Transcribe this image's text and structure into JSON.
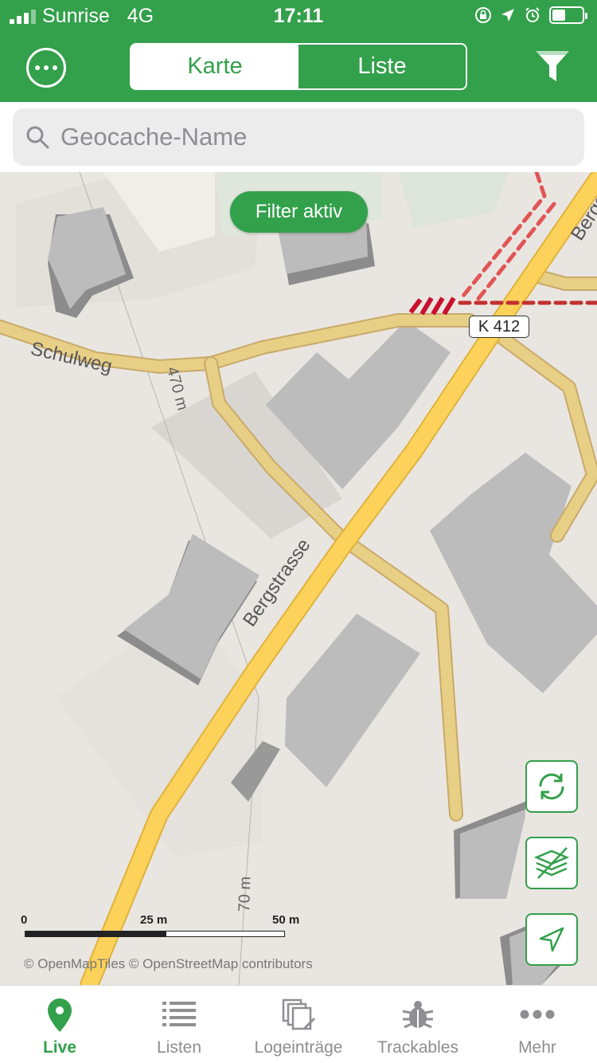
{
  "status_bar": {
    "carrier": "Sunrise",
    "network": "4G",
    "time": "17:11",
    "battery_level": 0.45
  },
  "nav": {
    "more_icon": "ellipsis-circle-icon",
    "segments": [
      {
        "label": "Karte",
        "selected": true
      },
      {
        "label": "Liste",
        "selected": false
      }
    ],
    "filter_icon": "funnel-icon"
  },
  "search": {
    "placeholder": "Geocache-Name",
    "value": "",
    "icon": "magnifier-icon"
  },
  "map": {
    "filter_badge": "Filter aktiv",
    "street_labels": [
      "Schulweg",
      "Bergstrasse",
      "Bergs"
    ],
    "road_shield": "K 412",
    "contour_labels": [
      "470 m",
      "70 m"
    ],
    "scale": {
      "labels": [
        "0",
        "25 m",
        "50 m"
      ]
    },
    "attribution": "© OpenMapTiles © OpenStreetMap contributors",
    "controls": [
      "refresh-icon",
      "layers-icon",
      "location-arrow-icon"
    ],
    "colors": {
      "road_major": "#fcd25a",
      "road_minor": "#e8cf86",
      "building": "#bdbcbc",
      "background": "#e9e6e1",
      "dashed_path": "#e05555"
    }
  },
  "tabbar": {
    "items": [
      {
        "label": "Live",
        "icon": "map-pin-icon",
        "active": true
      },
      {
        "label": "Listen",
        "icon": "list-icon",
        "active": false
      },
      {
        "label": "Logeinträge",
        "icon": "logs-icon",
        "active": false
      },
      {
        "label": "Trackables",
        "icon": "bug-icon",
        "active": false
      },
      {
        "label": "Mehr",
        "icon": "ellipsis-icon",
        "active": false
      }
    ]
  },
  "colors": {
    "accent": "#33a04b",
    "inactive": "#8e8e93"
  }
}
